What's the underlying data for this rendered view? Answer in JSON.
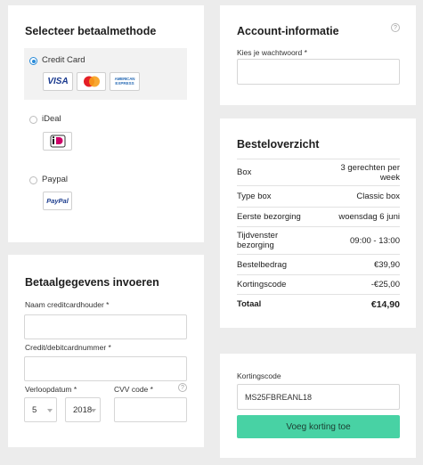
{
  "payment_method": {
    "title": "Selecteer betaalmethode",
    "options": [
      {
        "label": "Credit Card",
        "selected": true
      },
      {
        "label": "iDeal",
        "selected": false
      },
      {
        "label": "Paypal",
        "selected": false
      }
    ],
    "logos": {
      "visa": "VISA",
      "amex_top": "AMERICAN",
      "amex_bottom": "EXPRESS",
      "paypal": "PayPal"
    }
  },
  "payment_details": {
    "title": "Betaalgegevens invoeren",
    "cardholder_label": "Naam creditcardhouder *",
    "cardholder_value": "",
    "cardnumber_label": "Credit/debitcardnummer *",
    "cardnumber_value": "",
    "expiry_label": "Verloopdatum *",
    "expiry_month": "5",
    "expiry_year": "2018",
    "cvv_label": "CVV code *",
    "cvv_value": ""
  },
  "account": {
    "title": "Account-informatie",
    "password_label": "Kies je wachtwoord *",
    "password_value": ""
  },
  "order": {
    "title": "Besteloverzicht",
    "rows": [
      {
        "label": "Box",
        "value": "3 gerechten per week"
      },
      {
        "label": "Type box",
        "value": "Classic box"
      },
      {
        "label": "Eerste bezorging",
        "value": "woensdag 6 juni"
      },
      {
        "label": "Tijdvenster bezorging",
        "value": "09:00 - 13:00"
      },
      {
        "label": "Bestelbedrag",
        "value": "€39,90"
      },
      {
        "label": "Kortingscode",
        "value": "-€25,00"
      },
      {
        "label": "Totaal",
        "value": "€14,90"
      }
    ]
  },
  "discount": {
    "label": "Kortingscode",
    "code_value": "MS25FBREANL18",
    "apply_button": "Voeg korting toe"
  },
  "help_glyph": "?",
  "colors": {
    "accent_radio": "#2a8bd8",
    "button_green": "#48d2a4",
    "selected_option_bg": "#f2f2f2"
  }
}
